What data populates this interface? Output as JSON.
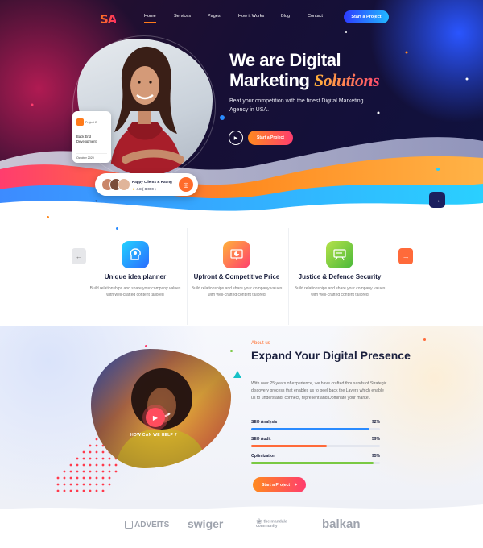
{
  "brand": {
    "logo": "SA"
  },
  "nav": {
    "items": [
      {
        "label": "Home",
        "active": true
      },
      {
        "label": "Services"
      },
      {
        "label": "Pages"
      },
      {
        "label": "How it Works"
      },
      {
        "label": "Blog"
      },
      {
        "label": "Contact"
      }
    ],
    "cta": "Start a Project"
  },
  "hero": {
    "title_line1": "We are Digital",
    "title_line2_plain": "Marketing ",
    "title_line2_accent": "Solutions",
    "subtitle": "Beat your competition with the finest Digital Marketing Agency in USA.",
    "cta": "Start a Project",
    "project_card": {
      "label": "Project 2",
      "title": "Back End Development",
      "date": "October 2020"
    },
    "clients_card": {
      "title": "Happy Clients & Rating",
      "rating": "4.8 ( 8,090 )"
    }
  },
  "features": [
    {
      "title": "Unique idea planner",
      "desc": "Build relationships and share your company values with well-crafted content tailored",
      "icon": "lightbulb-head-icon",
      "color": "#2a8bff"
    },
    {
      "title": "Upfront & Competitive Price",
      "desc": "Build relationships and share your company values with well-crafted content tailored",
      "icon": "chart-board-icon",
      "color": "#ff6a3a"
    },
    {
      "title": "Justice & Defence Security",
      "desc": "Build relationships and share your company values with well-crafted content tailored",
      "icon": "presentation-icon",
      "color": "#7ac943"
    }
  ],
  "about": {
    "kicker": "About us",
    "title": "Expand Your Digital Presence",
    "desc": "With over 25 years of experience, we have crafted thousands of Strategic discovery process that enables us to peel back the Layers which enable us to understand, connect, represent and Dominate your market.",
    "video_label": "HOW CAN WE HELP ?",
    "skills": [
      {
        "name": "SEO Analysis",
        "value": 92,
        "label": "92%",
        "color": "#2a8bff"
      },
      {
        "name": "SEO Audit",
        "value": 59,
        "label": "59%",
        "color": "#ff6a3a"
      },
      {
        "name": "Optimization",
        "value": 95,
        "label": "95%",
        "color": "#7ac943"
      }
    ],
    "cta": "Start a Project"
  },
  "partners": [
    "ADVEITS",
    "swiger",
    "the mandala community",
    "balkan"
  ]
}
